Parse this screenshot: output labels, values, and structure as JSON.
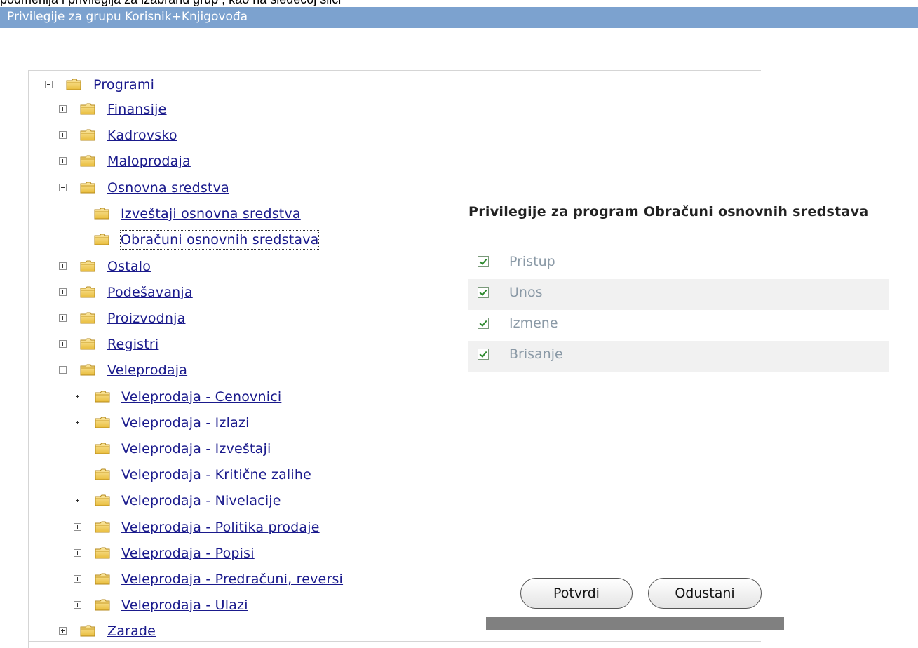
{
  "doc_text": "podmenija i privilegija  za izabranu grup , kao na sledećoj slici",
  "header": {
    "title": "Privilegije za grupu Korisnik+Knjigovođa"
  },
  "tree": {
    "root": {
      "label": "Programi",
      "expanded": true
    },
    "items": {
      "finansije": {
        "label": "Finansije",
        "expanded": false
      },
      "kadrovsko": {
        "label": "Kadrovsko",
        "expanded": false
      },
      "maloprodaja": {
        "label": "Maloprodaja",
        "expanded": false
      },
      "osnovna_sredstva": {
        "label": "Osnovna sredstva",
        "expanded": true
      },
      "izvestaji_os": {
        "label": "Izveštaji osnovna sredstva"
      },
      "obracuni_os": {
        "label": "Obračuni osnovnih sredstava",
        "selected": true
      },
      "ostalo": {
        "label": "Ostalo",
        "expanded": false
      },
      "podesavanja": {
        "label": "Podešavanja",
        "expanded": false
      },
      "proizvodnja": {
        "label": "Proizvodnja",
        "expanded": false
      },
      "registri": {
        "label": "Registri",
        "expanded": false
      },
      "veleprodaja": {
        "label": "Veleprodaja",
        "expanded": true
      },
      "vp_cenovnici": {
        "label": "Veleprodaja - Cenovnici",
        "expanded": false
      },
      "vp_izlazi": {
        "label": "Veleprodaja - Izlazi",
        "expanded": false
      },
      "vp_izvestaji": {
        "label": "Veleprodaja - Izveštaji"
      },
      "vp_kriticne": {
        "label": "Veleprodaja - Kritične zalihe"
      },
      "vp_nivelacije": {
        "label": "Veleprodaja - Nivelacije",
        "expanded": false
      },
      "vp_politika": {
        "label": "Veleprodaja - Politika prodaje",
        "expanded": false
      },
      "vp_popisi": {
        "label": "Veleprodaja - Popisi",
        "expanded": false
      },
      "vp_predracuni": {
        "label": "Veleprodaja - Predračuni, reversi",
        "expanded": false
      },
      "vp_ulazi": {
        "label": "Veleprodaja - Ulazi",
        "expanded": false
      },
      "zarade": {
        "label": "Zarade",
        "expanded": false
      }
    }
  },
  "privileges": {
    "title": "Privilegije za program Obračuni osnovnih sredstava",
    "items": [
      {
        "label": "Pristup",
        "checked": true
      },
      {
        "label": "Unos",
        "checked": true
      },
      {
        "label": "Izmene",
        "checked": true
      },
      {
        "label": "Brisanje",
        "checked": true
      }
    ]
  },
  "buttons": {
    "confirm": "Potvrdi",
    "cancel": "Odustani"
  },
  "colors": {
    "titlebar": "#7ca2cf",
    "link": "#1a1a8c",
    "folder": "#f2c94c",
    "muted_label": "#8a99a6"
  }
}
